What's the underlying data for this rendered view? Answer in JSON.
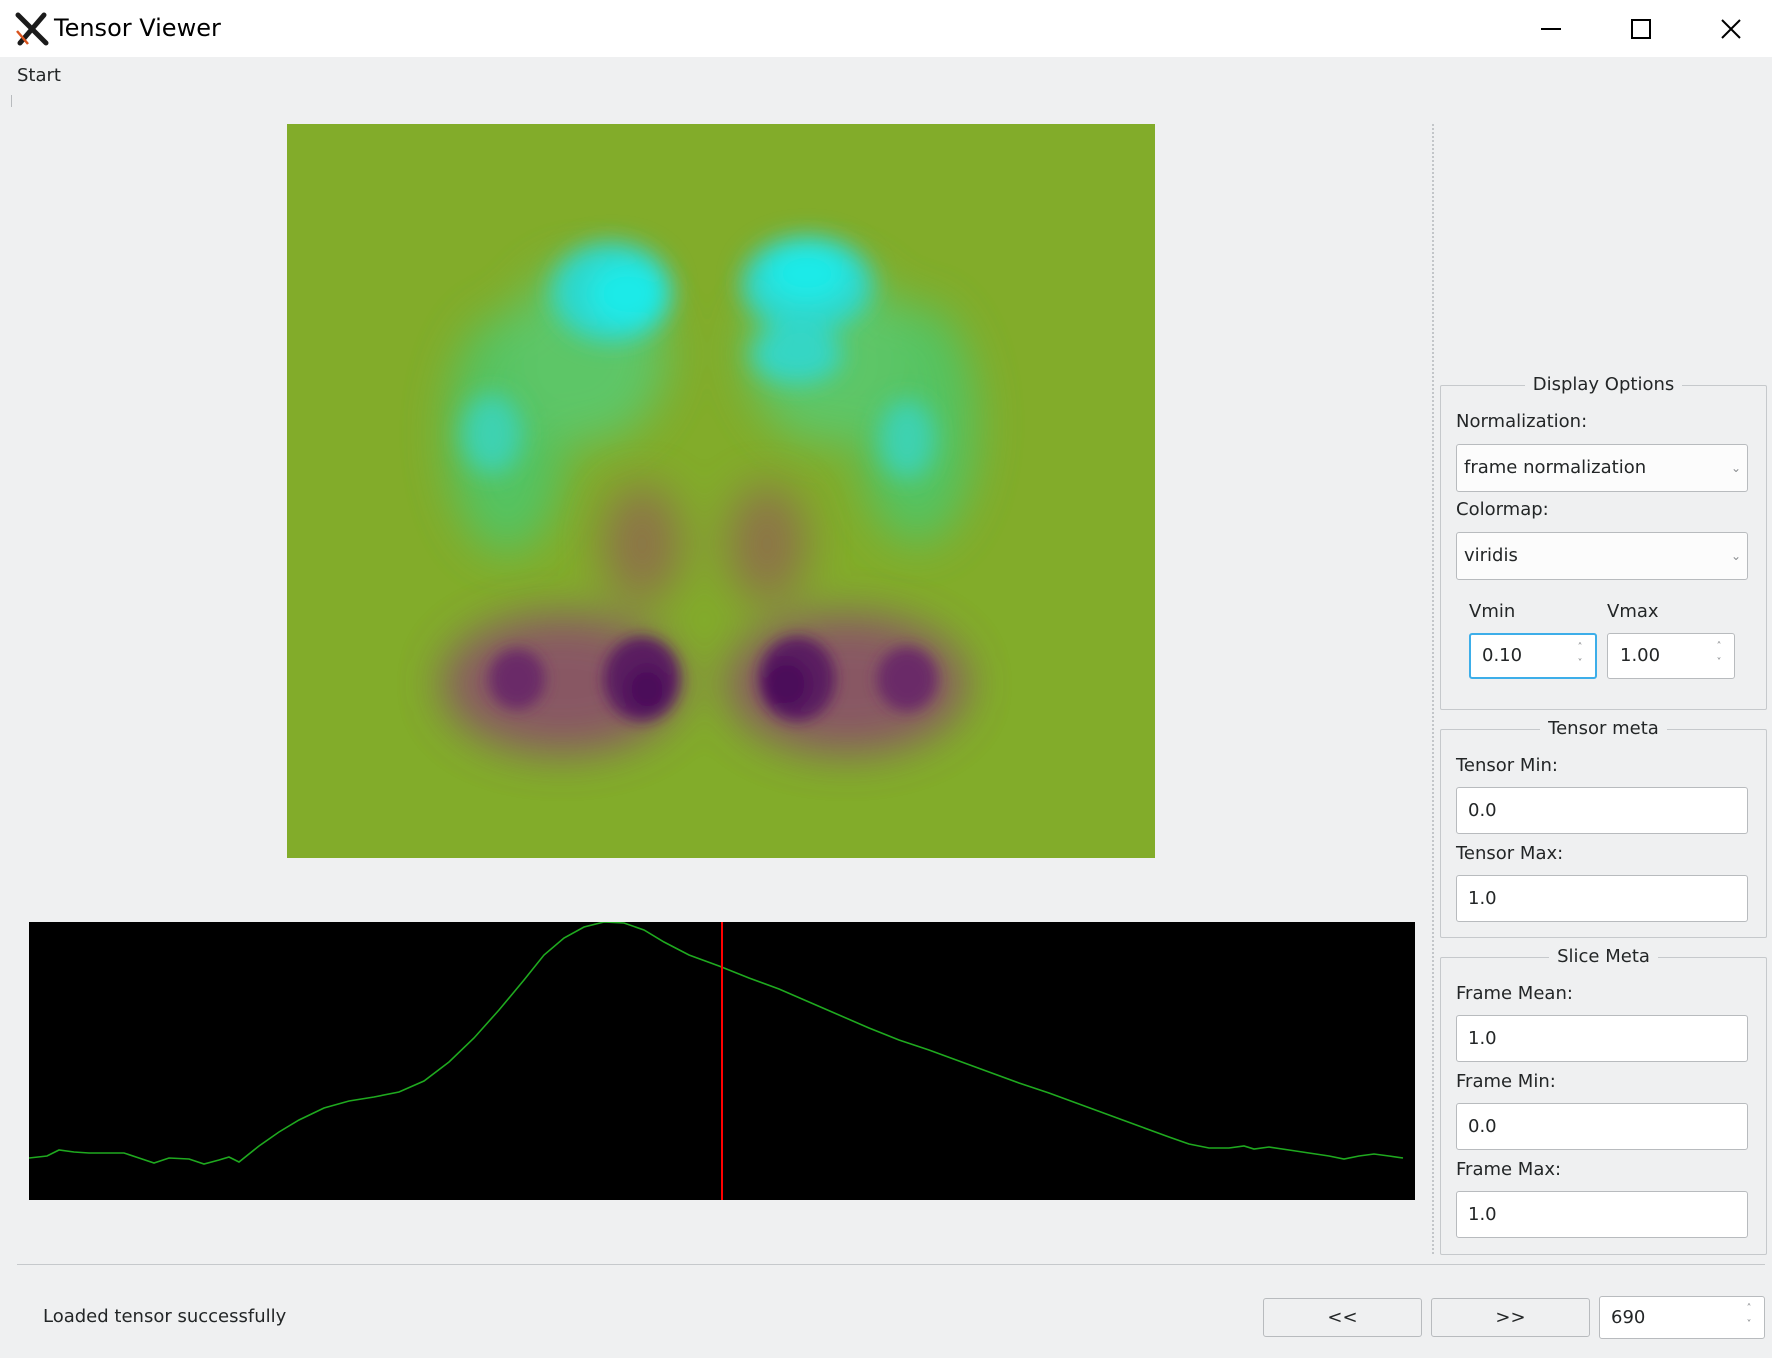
{
  "window": {
    "title": "Tensor Viewer",
    "icon": "x-logo-icon",
    "controls": [
      "minimize-icon",
      "maximize-icon",
      "close-icon"
    ]
  },
  "menu": {
    "items": [
      "Start"
    ]
  },
  "image_view": {
    "colormap_colors": {
      "background": "#82ac2a",
      "low": "#4b0c5a",
      "high": "#20e6e2"
    }
  },
  "trace_plot": {
    "background": "#000000",
    "line_color": "#1fa91f",
    "cursor_color": "#ff0000",
    "current_frame": 690
  },
  "display_options": {
    "title": "Display Options",
    "normalization_label": "Normalization:",
    "normalization_value": "frame normalization",
    "colormap_label": "Colormap:",
    "colormap_value": "viridis",
    "vmin_label": "Vmin",
    "vmin_value": "0.10",
    "vmax_label": "Vmax",
    "vmax_value": "1.00"
  },
  "tensor_meta": {
    "title": "Tensor meta",
    "min_label": "Tensor Min:",
    "min_value": "0.0",
    "max_label": "Tensor Max:",
    "max_value": "1.0"
  },
  "slice_meta": {
    "title": "Slice Meta",
    "mean_label": "Frame Mean:",
    "mean_value": "1.0",
    "min_label": "Frame Min:",
    "min_value": "0.0",
    "max_label": "Frame Max:",
    "max_value": "1.0"
  },
  "footer": {
    "status": "Loaded tensor successfully",
    "prev_label": "<<",
    "next_label": ">>",
    "frame_value": "690"
  }
}
